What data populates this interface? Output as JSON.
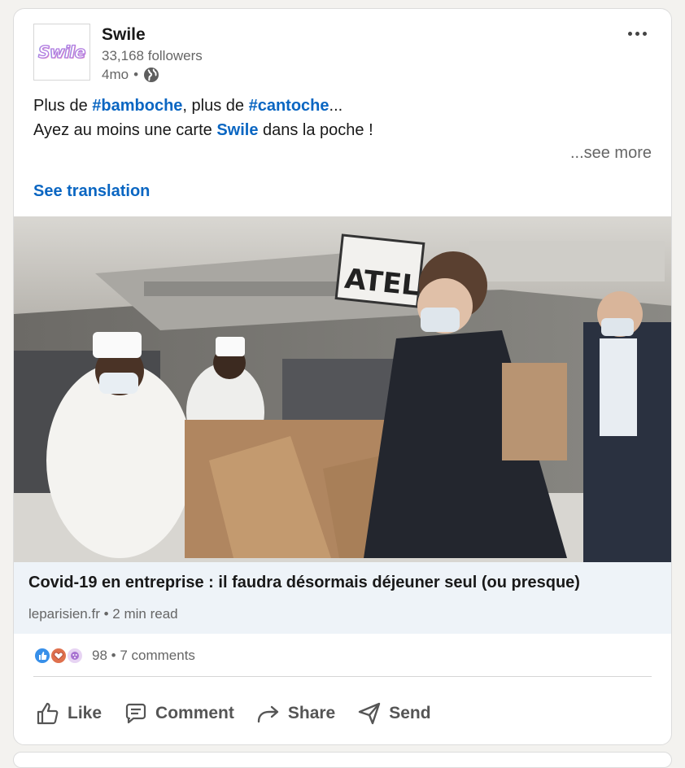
{
  "author": {
    "name": "Swile",
    "logo_text": "Swile",
    "followers": "33,168 followers",
    "time": "4mo",
    "separator": "•",
    "visibility_icon": "globe-icon"
  },
  "menu_icon": "more-horizontal-icon",
  "post": {
    "line1_prefix": "Plus de ",
    "line1_tag1": "#bamboche",
    "line1_mid": ", plus de ",
    "line1_tag2": "#cantoche",
    "line1_suffix": "...",
    "line2_prefix": "Ayez au moins une carte ",
    "line2_mention": "Swile",
    "line2_suffix": " dans la poche !",
    "see_more": "...see more",
    "see_translation": "See translation"
  },
  "article": {
    "image_sign": "ATELIER",
    "title": "Covid-19 en entreprise : il faudra désormais déjeuner seul (ou presque)",
    "source": "leparisien.fr",
    "separator": "•",
    "read_time": "2 min read"
  },
  "social": {
    "reactions": [
      "like-reaction-icon",
      "love-reaction-icon",
      "curious-reaction-icon"
    ],
    "count": "98",
    "separator": "•",
    "comments": "7 comments"
  },
  "actions": [
    {
      "label": "Like",
      "icon": "thumbs-up-icon"
    },
    {
      "label": "Comment",
      "icon": "comment-icon"
    },
    {
      "label": "Share",
      "icon": "share-arrow-icon"
    },
    {
      "label": "Send",
      "icon": "send-icon"
    }
  ],
  "colors": {
    "link_blue": "#0a66c2",
    "article_bg": "#eef3f8",
    "muted_text": "#666666"
  }
}
